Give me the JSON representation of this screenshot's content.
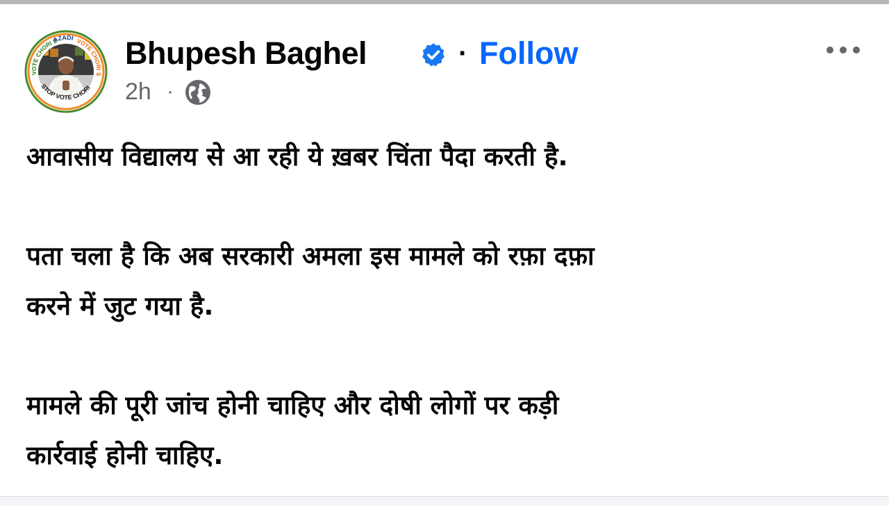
{
  "post": {
    "author": "Bhupesh Baghel",
    "follow_label": "Follow",
    "separator": "·",
    "timestamp": "2h",
    "meta_separator": "·",
    "audience_icon": "globe-icon",
    "verified_icon": "verified-badge-icon",
    "more_icon": "more-options-icon",
    "avatar_text": [
      "VOTE CHORI SE",
      "AZADI",
      "VOTE CHORI SE",
      "STOP VOTE CHORI"
    ],
    "paragraphs": [
      "आवासीय विद्यालय से आ रही ये ख़बर चिंता पैदा करती है.",
      "पता चला है कि अब सरकारी अमला इस मामले को रफ़ा दफ़ा\nकरने में जुट गया है.",
      "मामले की पूरी जांच होनी चाहिए और दोषी लोगों पर कड़ी\nकार्रवाई होनी चाहिए."
    ]
  },
  "colors": {
    "accent": "#0866ff",
    "verified": "#1877f2",
    "meta_text": "#65676b",
    "body_text": "#050505"
  }
}
